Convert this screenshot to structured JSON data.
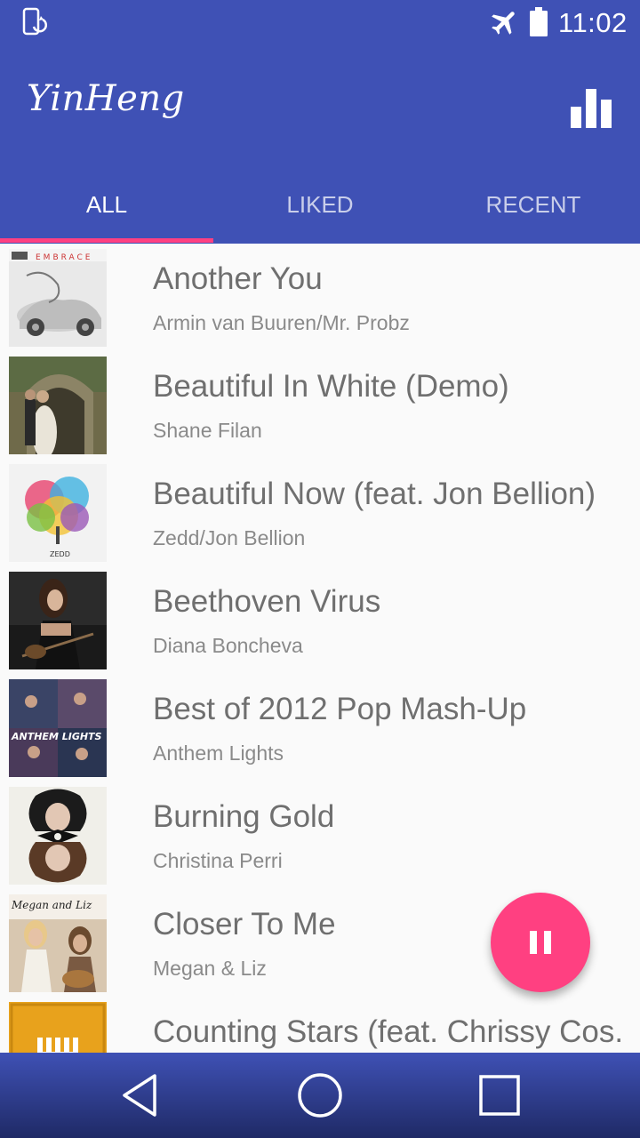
{
  "status_bar": {
    "time": "11:02",
    "left_icon": "phone-rotate-icon",
    "airplane_icon": "airplane-icon",
    "battery_icon": "battery-icon"
  },
  "app_bar": {
    "title": "YinHeng",
    "action_icon": "equalizer-icon"
  },
  "tabs": [
    {
      "label": "ALL",
      "active": true
    },
    {
      "label": "LIKED",
      "active": false
    },
    {
      "label": "RECENT",
      "active": false
    }
  ],
  "songs": [
    {
      "title": "Another You",
      "artist": "Armin van Buuren/Mr. Probz",
      "album_art_text": "EMBRACE"
    },
    {
      "title": "Beautiful In White (Demo)",
      "artist": "Shane Filan"
    },
    {
      "title": "Beautiful Now (feat. Jon Bellion)",
      "artist": "Zedd/Jon Bellion",
      "album_art_text": "ZEDD"
    },
    {
      "title": "Beethoven Virus",
      "artist": "Diana Boncheva"
    },
    {
      "title": "Best of 2012 Pop Mash-Up",
      "artist": "Anthem Lights",
      "album_art_text": "ANTHEM LIGHTS"
    },
    {
      "title": "Burning Gold",
      "artist": "Christina Perri"
    },
    {
      "title": "Closer To Me",
      "artist": "Megan & Liz",
      "album_art_text": "Megan and Liz"
    },
    {
      "title": "Counting Stars (feat. Chrissy Cos.",
      "artist": ""
    }
  ],
  "fab": {
    "icon": "pause-icon"
  },
  "nav_bar": {
    "back_icon": "back-icon",
    "home_icon": "home-icon",
    "recents_icon": "recents-icon"
  },
  "colors": {
    "primary": "#3f51b5",
    "accent": "#ff4081",
    "background": "#fafafa"
  }
}
